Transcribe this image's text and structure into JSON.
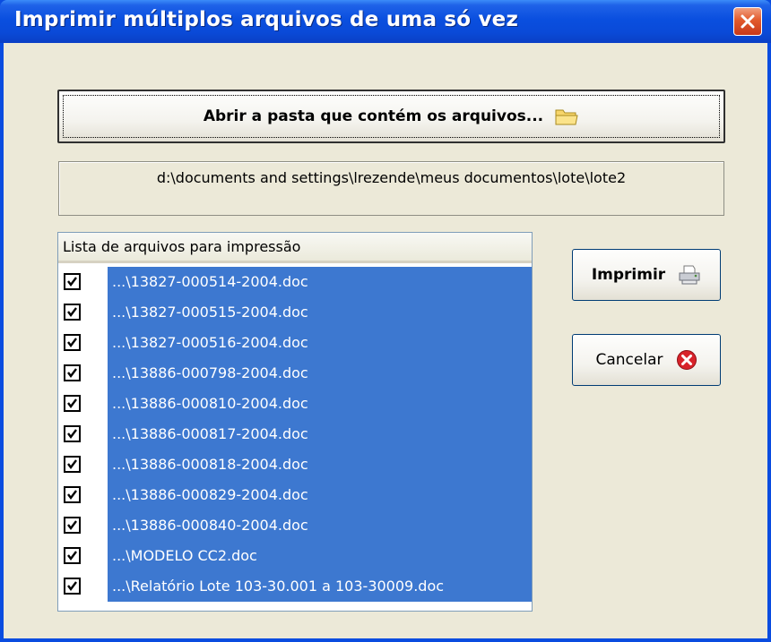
{
  "window": {
    "title": "Imprimir múltiplos arquivos de uma só vez"
  },
  "toolbar": {
    "open_folder_label": "Abrir a pasta que contém os arquivos..."
  },
  "path": {
    "value": "d:\\documents and settings\\lrezende\\meus documentos\\lote\\lote2"
  },
  "file_list": {
    "header": "Lista de arquivos para impressão",
    "items": [
      {
        "name": "...\\13827-000514-2004.doc",
        "checked": true
      },
      {
        "name": "...\\13827-000515-2004.doc",
        "checked": true
      },
      {
        "name": "...\\13827-000516-2004.doc",
        "checked": true
      },
      {
        "name": "...\\13886-000798-2004.doc",
        "checked": true
      },
      {
        "name": "...\\13886-000810-2004.doc",
        "checked": true
      },
      {
        "name": "...\\13886-000817-2004.doc",
        "checked": true
      },
      {
        "name": "...\\13886-000818-2004.doc",
        "checked": true
      },
      {
        "name": "...\\13886-000829-2004.doc",
        "checked": true
      },
      {
        "name": "...\\13886-000840-2004.doc",
        "checked": true
      },
      {
        "name": "...\\MODELO CC2.doc",
        "checked": true
      },
      {
        "name": "...\\Relatório Lote 103-30.001 a 103-30009.doc",
        "checked": true
      }
    ]
  },
  "actions": {
    "print_label": "Imprimir",
    "cancel_label": "Cancelar"
  },
  "colors": {
    "selection": "#3d78d0",
    "window_bg": "#ece9d8",
    "titlebar": "#0a4fdf",
    "close": "#e25a2c"
  },
  "icons": {
    "open_folder": "folder-icon",
    "print": "printer-icon",
    "cancel": "cancel-icon",
    "close": "close-icon",
    "check": "check-icon"
  }
}
